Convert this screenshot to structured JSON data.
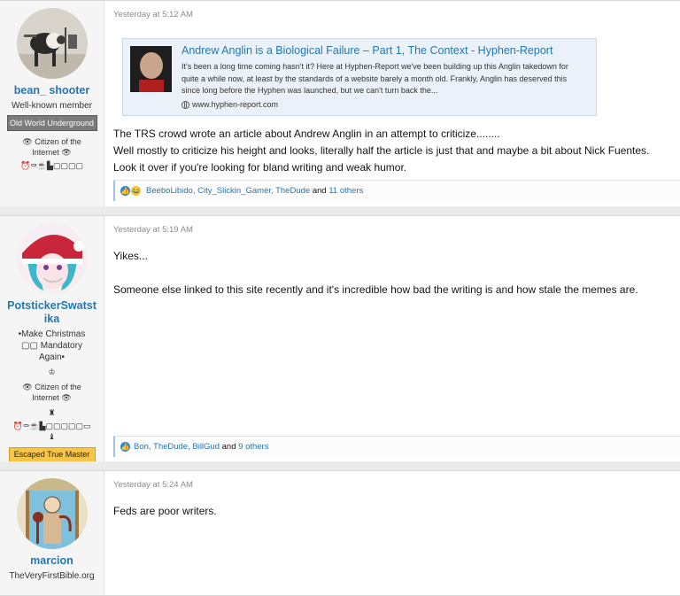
{
  "posts": [
    {
      "author": {
        "name": "bean_ shooter",
        "title": "Well-known member",
        "banner": "Old World Underground",
        "extra": "👁 Citizen of the Internet 👁",
        "icons": "⏰⚰☕▙▢▢▢▢"
      },
      "date": "Yesterday at 5:12 AM",
      "unfurl": {
        "title": "Andrew Anglin is a Biological Failure – Part 1, The Context - Hyphen-Report",
        "desc": "It's been a long time coming hasn't it? Here at Hyphen-Report we've been building up this Anglin takedown for quite a while now, at least by the standards of a website barely a month old. Frankly, Anglin has deserved this since long before the Hyphen was launched, but we can't turn back the...",
        "source": "www.hyphen-report.com"
      },
      "lines": [
        "The TRS crowd wrote an article about Andrew Anglin in an attempt to criticize........",
        "Well mostly to criticize his height and looks, literally half the article is just that and maybe a bit about Nick Fuentes.",
        "Look it over if you're looking for bland writing and weak humor."
      ],
      "reactions": {
        "names": "BeeboLibido, City_Slickin_Gamer, TheDude",
        "and": "and",
        "others": "11 others"
      }
    },
    {
      "author": {
        "name": "PotstickerSwatstika",
        "title": "•Make Christmas ▢▢ Mandatory Again•",
        "extra": "👁 Citizen of the Internet 👁",
        "icons": "⏰⚰☕▙▢▢▢▢▢▭♝",
        "banner": "Escaped True Master"
      },
      "date": "Yesterday at 5:19 AM",
      "lines": [
        "Yikes...",
        "Someone else linked to this site recently and it's incredible how bad the writing is and how stale the memes are."
      ],
      "reactions": {
        "names": "Bon, TheDude, BillGud",
        "and": "and",
        "others": "9 others"
      }
    },
    {
      "author": {
        "name": "marcion",
        "title": "TheVeryFirstBible.org"
      },
      "date": "Yesterday at 5:24 AM",
      "lines": [
        "Feds are poor writers."
      ]
    }
  ]
}
